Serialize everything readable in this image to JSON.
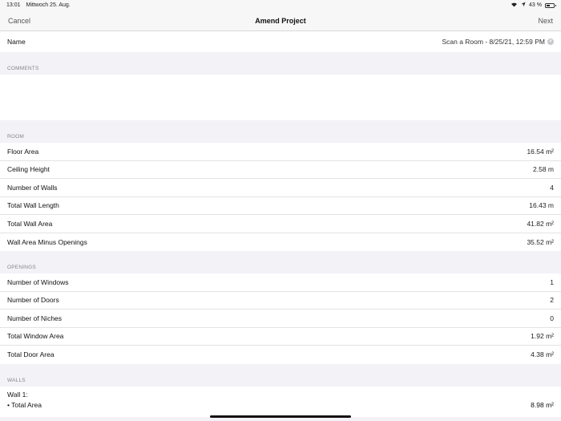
{
  "status": {
    "time": "13:01",
    "date": "Mittwoch 25. Aug.",
    "battery": "43 %"
  },
  "nav": {
    "cancel": "Cancel",
    "title": "Amend Project",
    "next": "Next"
  },
  "name": {
    "label": "Name",
    "value": "Scan a Room - 8/25/21, 12:59 PM"
  },
  "sections": {
    "comments": "COMMENTS",
    "room": "ROOM",
    "openings": "OPENINGS",
    "walls": "WALLS"
  },
  "room": [
    {
      "label": "Floor Area",
      "value": "16.54 m²"
    },
    {
      "label": "Ceiling Height",
      "value": "2.58 m"
    },
    {
      "label": "Number of Walls",
      "value": "4"
    },
    {
      "label": "Total Wall Length",
      "value": "16.43 m"
    },
    {
      "label": "Total Wall Area",
      "value": "41.82 m²"
    },
    {
      "label": "Wall Area Minus Openings",
      "value": "35.52 m²"
    }
  ],
  "openings": [
    {
      "label": "Number of Windows",
      "value": "1"
    },
    {
      "label": "Number of Doors",
      "value": "2"
    },
    {
      "label": "Number of Niches",
      "value": "0"
    },
    {
      "label": "Total Window Area",
      "value": "1.92 m²"
    },
    {
      "label": "Total Door Area",
      "value": "4.38 m²"
    }
  ],
  "walls": {
    "title": "Wall 1:",
    "item_label": "• Total Area",
    "item_value": "8.98 m²"
  }
}
